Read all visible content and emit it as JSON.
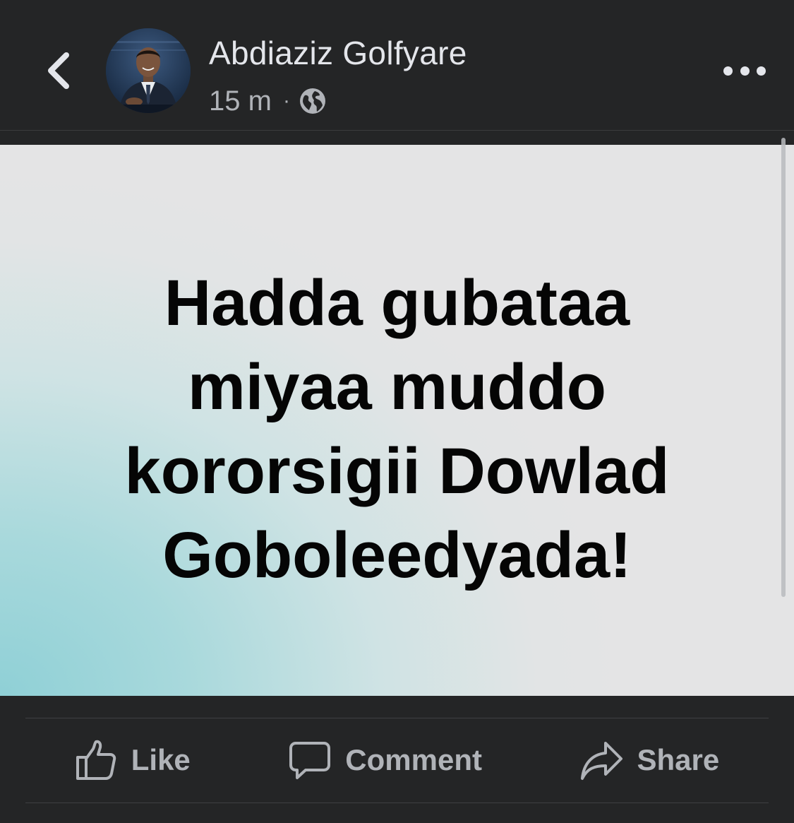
{
  "header": {
    "author_name": "Abdiaziz Golfyare",
    "time_ago": "15 m",
    "separator": "·",
    "privacy_icon": "globe-icon",
    "back_icon": "chevron-left-icon",
    "more_icon": "more-horizontal-icon"
  },
  "post": {
    "text": "Hadda gubataa\nmiyaa muddo\nkororsigii Dowlad\nGoboleedyada!",
    "background_colors": [
      "#8fd0d6",
      "#e4e4e5"
    ],
    "text_color": "#050505"
  },
  "actions": {
    "like_label": "Like",
    "comment_label": "Comment",
    "share_label": "Share"
  },
  "colors": {
    "app_background": "#242526",
    "primary_text": "#e4e6eb",
    "secondary_text": "#b0b3b8"
  }
}
